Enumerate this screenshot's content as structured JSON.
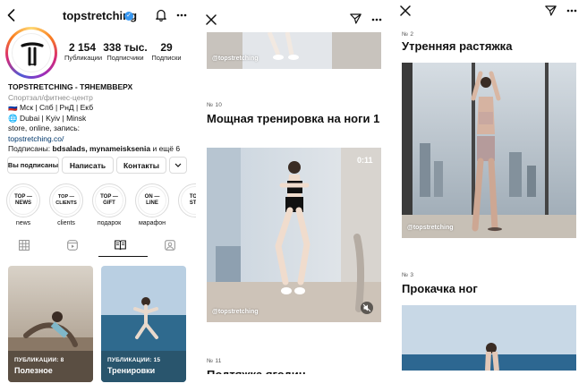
{
  "profile": {
    "username": "topstretching",
    "stats": [
      {
        "value": "2 154",
        "label": "Публикации"
      },
      {
        "value": "338 тыс.",
        "label": "Подписчики"
      },
      {
        "value": "29",
        "label": "Подписки"
      }
    ],
    "bio": {
      "name": "TOPSTRETCHING - ТЯНЕМВВЕРХ",
      "category": "Спортзал/фитнес-центр",
      "line1": "🇷🇺 Мск | Спб | РнД | Екб",
      "line2": "🌐 Dubai | Kyiv | Minsk",
      "line3": "store, online, запись:",
      "link": "topstretching.co/",
      "followed_prefix": "Подписаны: ",
      "followed_names": "bdsalads, mynameisksenia",
      "followed_suffix": " и ещё 6"
    },
    "buttons": {
      "following": "Вы подписаны",
      "message": "Написать",
      "contacts": "Контакты"
    },
    "highlights": [
      {
        "cover": "TOP —\nNEWS",
        "label": "news"
      },
      {
        "cover": "TOP —\nCLIENTS",
        "label": "clients"
      },
      {
        "cover": "TOP —\nGIFT",
        "label": "подарок"
      },
      {
        "cover": "ON —\nLINE",
        "label": "марафон"
      },
      {
        "cover": "TOP\nSTO",
        "label": ""
      }
    ],
    "guides": [
      {
        "meta": "ПУБЛИКАЦИИ: 8",
        "title": "Полезное"
      },
      {
        "meta": "ПУБЛИКАЦИИ: 15",
        "title": "Тренировки"
      }
    ]
  },
  "guide_view": {
    "watermark": "@topstretching",
    "items": [
      {
        "num": "№ 10",
        "title": "Мощная тренировка на ноги 1",
        "time": "0:11"
      },
      {
        "num": "№ 11",
        "title": "Подтяжка ягодиц"
      }
    ]
  },
  "guide_view2": {
    "watermark": "@topstretching",
    "items": [
      {
        "num": "№ 2",
        "title": "Утренняя растяжка"
      },
      {
        "num": "№ 3",
        "title": "Прокачка ног"
      }
    ]
  },
  "colors": {
    "verified": "#3897f0",
    "link": "#00376b",
    "sea": "#3f6f8e",
    "sky": "#c9d6e2"
  }
}
